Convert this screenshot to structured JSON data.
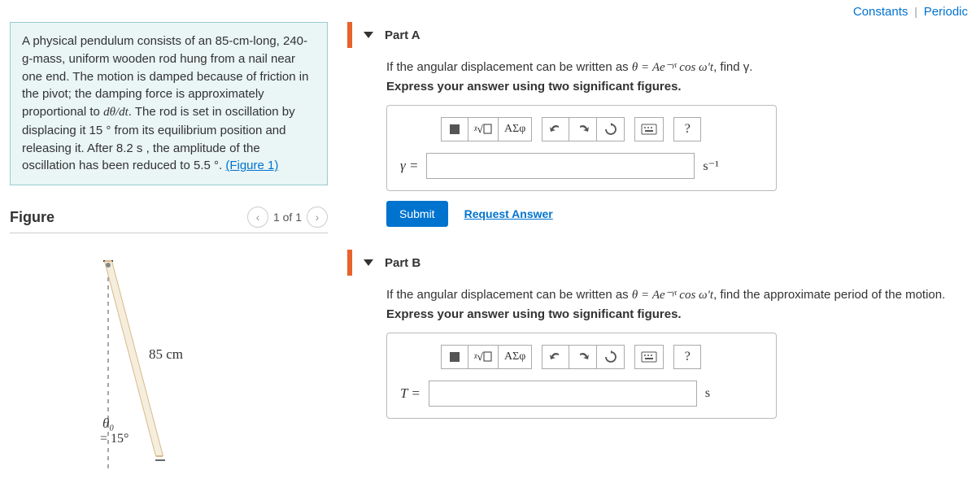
{
  "top_links": {
    "constants": "Constants",
    "periodic": "Periodic"
  },
  "problem": {
    "text_pre": "A physical pendulum consists of an 85-cm-long, 240-g-mass, uniform wooden rod hung from a nail near one end. The motion is damped because of friction in the pivot; the damping force is approximately proportional to ",
    "dtheta": "dθ/dt",
    "text_mid": ". The rod is set in oscillation by displacing it 15 ° from its equilibrium position and releasing it. After 8.2 s , the amplitude of the oscillation has been reduced to 5.5 °. ",
    "figure_link": "(Figure 1)"
  },
  "figure": {
    "title": "Figure",
    "counter": "1 of 1",
    "length_label": "85 cm",
    "theta0": "θ₀",
    "angle_label": "= 15°"
  },
  "partA": {
    "title": "Part A",
    "prompt_pre": "If the angular displacement can be written as ",
    "prompt_eq": "θ = Ae⁻ᵞᵗ cos ω′t",
    "prompt_post": ", find γ.",
    "instruction": "Express your answer using two significant figures.",
    "var_label": "γ =",
    "unit": "s⁻¹",
    "submit": "Submit",
    "request": "Request Answer",
    "greek": "ΑΣφ",
    "help": "?"
  },
  "partB": {
    "title": "Part B",
    "prompt_pre": "If the angular displacement can be written as ",
    "prompt_eq": "θ = Ae⁻ᵞᵗ cos ω′t",
    "prompt_post": ", find the approximate period of the motion.",
    "instruction": "Express your answer using two significant figures.",
    "var_label": "T =",
    "unit": "s",
    "greek": "ΑΣφ",
    "help": "?"
  }
}
